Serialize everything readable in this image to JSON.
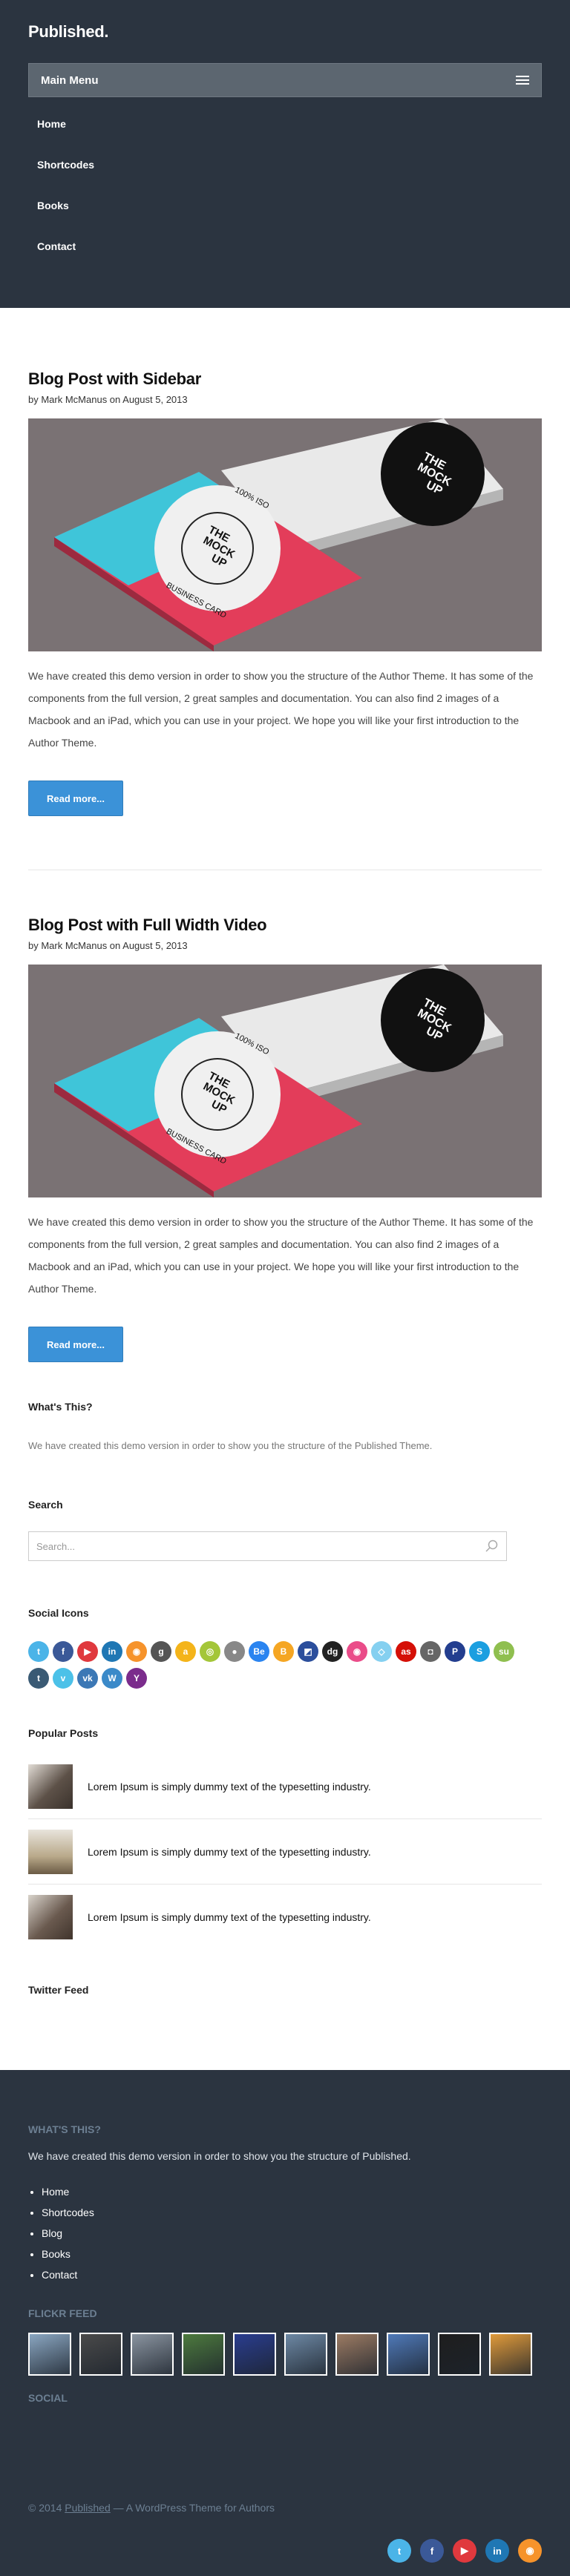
{
  "site": {
    "logo": "Published."
  },
  "menu": {
    "label": "Main Menu",
    "items": [
      "Home",
      "Shortcodes",
      "Books",
      "Contact"
    ]
  },
  "posts": [
    {
      "title": "Blog Post with Sidebar",
      "byline": "by Mark McManus on August 5, 2013",
      "excerpt": "We have created this demo version in order to show you the structure of the Author Theme. It has some of the components from the full version, 2 great samples and documentation. You can also find 2 images of a Macbook and an iPad, which you can use in your project. We hope you will like your first introduction to the Author Theme.",
      "read_more": "Read more..."
    },
    {
      "title": "Blog Post with Full Width Video",
      "byline": "by Mark McManus on August 5, 2013",
      "excerpt": "We have created this demo version in order to show you the structure of the Author Theme. It has some of the components from the full version, 2 great samples and documentation. You can also find 2 images of a Macbook and an iPad, which you can use in your project. We hope you will like your first introduction to the Author Theme.",
      "read_more": "Read more..."
    }
  ],
  "card_mock": {
    "line1": "THE",
    "line2": "MOCK",
    "line3": "UP",
    "ring_top": "100% ISO",
    "ring_bottom": "BUSINESS CARD"
  },
  "whats_this": {
    "title": "What's This?",
    "text": "We have created this demo version in order to show you the structure of the Published Theme."
  },
  "search": {
    "title": "Search",
    "placeholder": "Search..."
  },
  "social_icons": {
    "title": "Social Icons",
    "icons": [
      {
        "name": "twitter",
        "color": "#4bb4e8",
        "glyph": "t"
      },
      {
        "name": "facebook",
        "color": "#3b5998",
        "glyph": "f"
      },
      {
        "name": "youtube",
        "color": "#e0393e",
        "glyph": "▶"
      },
      {
        "name": "linkedin",
        "color": "#1f77b4",
        "glyph": "in"
      },
      {
        "name": "rss",
        "color": "#f6932b",
        "glyph": "◉"
      },
      {
        "name": "google-plus",
        "color": "#555555",
        "glyph": "g"
      },
      {
        "name": "amazon",
        "color": "#f4b41a",
        "glyph": "a"
      },
      {
        "name": "android",
        "color": "#a4c639",
        "glyph": "◎"
      },
      {
        "name": "apple",
        "color": "#888888",
        "glyph": "●"
      },
      {
        "name": "behance",
        "color": "#2a84f0",
        "glyph": "Be"
      },
      {
        "name": "blogger",
        "color": "#f5a623",
        "glyph": "B"
      },
      {
        "name": "delicious",
        "color": "#2b4e9c",
        "glyph": "◩"
      },
      {
        "name": "digg",
        "color": "#222222",
        "glyph": "dg"
      },
      {
        "name": "dribbble",
        "color": "#ea4c89",
        "glyph": "◉"
      },
      {
        "name": "dropbox",
        "color": "#85d0f0",
        "glyph": "◇"
      },
      {
        "name": "lastfm",
        "color": "#d51007",
        "glyph": "as"
      },
      {
        "name": "instagram",
        "color": "#666666",
        "glyph": "◘"
      },
      {
        "name": "paypal",
        "color": "#233e8f",
        "glyph": "P"
      },
      {
        "name": "skype",
        "color": "#1b9fe0",
        "glyph": "S"
      },
      {
        "name": "stumbleupon",
        "color": "#8fbf4f",
        "glyph": "su"
      },
      {
        "name": "tumblr",
        "color": "#3a5a74",
        "glyph": "t"
      },
      {
        "name": "vimeo",
        "color": "#4cc1e8",
        "glyph": "v"
      },
      {
        "name": "vk",
        "color": "#3c78b5",
        "glyph": "vk"
      },
      {
        "name": "wordpress",
        "color": "#3b8ac9",
        "glyph": "W"
      },
      {
        "name": "yahoo",
        "color": "#7b2c8c",
        "glyph": "Y"
      }
    ]
  },
  "popular_posts": {
    "title": "Popular Posts",
    "items": [
      {
        "text": "Lorem Ipsum is simply dummy text of the typesetting industry.",
        "thumb_color": "#5d5148"
      },
      {
        "text": "Lorem Ipsum is simply dummy text of the typesetting industry.",
        "thumb_color": "#b9a98a"
      },
      {
        "text": "Lorem Ipsum is simply dummy text of the typesetting industry.",
        "thumb_color": "#6a5a4f"
      }
    ]
  },
  "twitter_feed": {
    "title": "Twitter Feed"
  },
  "footer": {
    "whats_this_title": "What's This?",
    "whats_this_text": "We have created this demo version in order to show you the structure of Published.",
    "links": [
      "Home",
      "Shortcodes",
      "Blog",
      "Books",
      "Contact"
    ],
    "flickr_title": "Flickr Feed",
    "flickr_colors": [
      "#8aa6c1",
      "#4a4a4a",
      "#8a94a0",
      "#4d7a3e",
      "#2a3d8f",
      "#6d88a4",
      "#9c7b63",
      "#4f79b8",
      "#1e1e1e",
      "#e09a3a"
    ],
    "social_title": "Social",
    "copyright_prefix": "© 2014",
    "copyright_link": "Published",
    "copyright_suffix": "— A WordPress Theme for Authors",
    "social": [
      {
        "name": "twitter",
        "color": "#4bb4e8",
        "glyph": "t"
      },
      {
        "name": "facebook",
        "color": "#3b5998",
        "glyph": "f"
      },
      {
        "name": "youtube",
        "color": "#e0393e",
        "glyph": "▶"
      },
      {
        "name": "linkedin",
        "color": "#1f77b4",
        "glyph": "in"
      },
      {
        "name": "rss",
        "color": "#f6932b",
        "glyph": "◉"
      }
    ]
  }
}
